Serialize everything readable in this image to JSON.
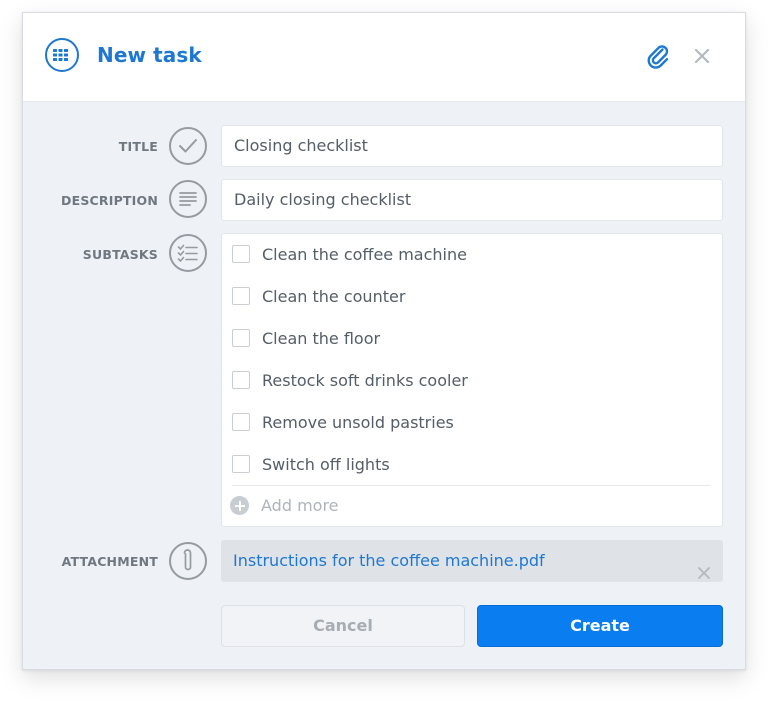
{
  "header": {
    "title": "New task",
    "accent_color": "#1d78d2",
    "icons": {
      "app": "task-list-icon",
      "attach": "paperclip-icon",
      "close": "close-icon"
    }
  },
  "form": {
    "title": {
      "label": "TITLE",
      "icon": "checkmark-icon",
      "value": "Closing checklist"
    },
    "description": {
      "label": "DESCRIPTION",
      "icon": "text-lines-icon",
      "value": "Daily closing checklist"
    },
    "subtasks": {
      "label": "SUBTASKS",
      "icon": "checklist-icon",
      "items": [
        {
          "label": "Clean the coffee machine",
          "checked": false
        },
        {
          "label": "Clean the counter",
          "checked": false
        },
        {
          "label": "Clean the floor",
          "checked": false
        },
        {
          "label": "Restock soft drinks cooler",
          "checked": false
        },
        {
          "label": "Remove unsold pastries",
          "checked": false
        },
        {
          "label": "Switch off lights",
          "checked": false
        }
      ],
      "add_more_placeholder": "Add more"
    },
    "attachment": {
      "label": "ATTACHMENT",
      "icon": "paperclip-icon",
      "file_name": "Instructions for the coffee machine.pdf"
    }
  },
  "actions": {
    "cancel_label": "Cancel",
    "create_label": "Create",
    "primary_color": "#0a7ef0"
  }
}
